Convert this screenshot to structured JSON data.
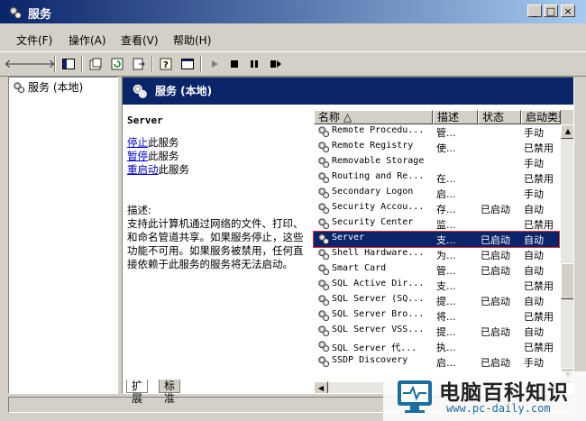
{
  "window": {
    "title": "服务",
    "min": "_",
    "max": "□",
    "close": "×"
  },
  "menu": [
    "文件(F)",
    "操作(A)",
    "查看(V)",
    "帮助(H)"
  ],
  "tree": {
    "root": "服务 (本地)"
  },
  "panel": {
    "header": "服务 (本地)"
  },
  "detail": {
    "service_name": "Server",
    "links": [
      {
        "link": "停止",
        "rest": "此服务"
      },
      {
        "link": "暂停",
        "rest": "此服务"
      },
      {
        "link": "重启动",
        "rest": "此服务"
      }
    ],
    "desc_label": "描述:",
    "desc_text": "支持此计算机通过网络的文件、打印、和命名管道共享。如果服务停止，这些功能不可用。如果服务被禁用，任何直接依赖于此服务的服务将无法启动。"
  },
  "columns": [
    "名称 △",
    "描述",
    "状态",
    "启动类型"
  ],
  "rows": [
    {
      "name": "Remote Procedu...",
      "desc": "管...",
      "status": "",
      "startup": "手动"
    },
    {
      "name": "Remote Registry",
      "desc": "使...",
      "status": "",
      "startup": "已禁用"
    },
    {
      "name": "Removable Storage",
      "desc": "",
      "status": "",
      "startup": "手动"
    },
    {
      "name": "Routing and Re...",
      "desc": "在...",
      "status": "",
      "startup": "已禁用"
    },
    {
      "name": "Secondary Logon",
      "desc": "启...",
      "status": "",
      "startup": "手动"
    },
    {
      "name": "Security Accou...",
      "desc": "存...",
      "status": "已启动",
      "startup": "自动"
    },
    {
      "name": "Security Center",
      "desc": "监...",
      "status": "",
      "startup": "已禁用"
    },
    {
      "name": "Server",
      "desc": "支...",
      "status": "已启动",
      "startup": "自动",
      "selected": true
    },
    {
      "name": "Shell Hardware...",
      "desc": "为...",
      "status": "已启动",
      "startup": "自动"
    },
    {
      "name": "Smart Card",
      "desc": "管...",
      "status": "已启动",
      "startup": "自动"
    },
    {
      "name": "SQL Active Dir...",
      "desc": "支...",
      "status": "",
      "startup": "已禁用"
    },
    {
      "name": "SQL Server (SQ...",
      "desc": "提...",
      "status": "已启动",
      "startup": "自动"
    },
    {
      "name": "SQL Server Bro...",
      "desc": "将...",
      "status": "",
      "startup": "已禁用"
    },
    {
      "name": "SQL Server VSS...",
      "desc": "提...",
      "status": "已启动",
      "startup": "自动"
    },
    {
      "name": "SQL Server 代...",
      "desc": "执...",
      "status": "",
      "startup": "已禁用"
    },
    {
      "name": "SSDP Discovery",
      "desc": "启...",
      "status": "已启动",
      "startup": "手动"
    }
  ],
  "tabs": [
    "扩展",
    "标准"
  ],
  "watermark": {
    "title": "电脑百科知识",
    "url": "www.pc-daily.com"
  }
}
